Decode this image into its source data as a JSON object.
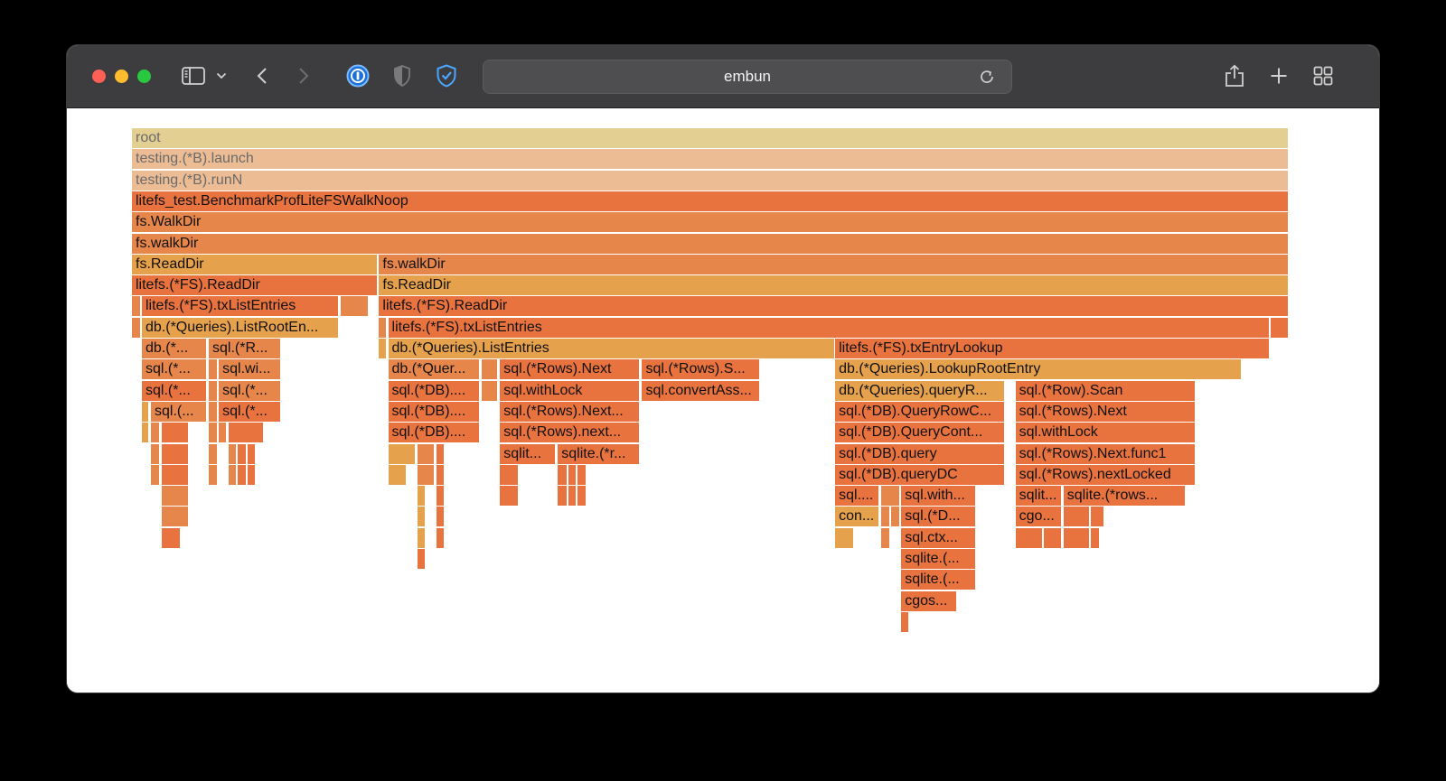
{
  "browser": {
    "url": "embun",
    "icons": {
      "sidebar": "sidebar-icon",
      "tab_menu": "chevron-down-icon",
      "back": "chevron-left-icon",
      "forward": "chevron-right-icon",
      "extension_1": "1password-icon",
      "extension_2": "shield-half-icon",
      "extension_3": "shield-check-icon",
      "reload": "reload-icon",
      "share": "share-icon",
      "new_tab": "plus-icon",
      "tab_overview": "grid-icon"
    }
  },
  "flamegraph": {
    "colors": {
      "root": "#e4cf93",
      "pale": "#ecbd95",
      "red": "#e9733f",
      "orange": "#e7864a",
      "amber": "#e6a14d"
    },
    "frames": [
      {
        "label": "root",
        "c": "root",
        "d": 0,
        "s": 0,
        "e": 1
      },
      {
        "label": "testing.(*B).launch",
        "c": "pale",
        "d": 1,
        "s": 0,
        "e": 1
      },
      {
        "label": "testing.(*B).runN",
        "c": "pale",
        "d": 2,
        "s": 0,
        "e": 1
      },
      {
        "label": "litefs_test.BenchmarkProfLiteFSWalkNoop",
        "c": "red",
        "d": 3,
        "s": 0,
        "e": 1
      },
      {
        "label": "fs.WalkDir",
        "c": "orange",
        "d": 4,
        "s": 0,
        "e": 1
      },
      {
        "label": "fs.walkDir",
        "c": "orange",
        "d": 5,
        "s": 0,
        "e": 1
      },
      {
        "label": "fs.ReadDir",
        "c": "amber",
        "d": 6,
        "s": 0,
        "e": 0.2128
      },
      {
        "label": "fs.walkDir",
        "c": "orange",
        "d": 6,
        "s": 0.2136,
        "e": 1
      },
      {
        "label": "litefs.(*FS).ReadDir",
        "c": "red",
        "d": 7,
        "s": 0,
        "e": 0.2128
      },
      {
        "label": "fs.ReadDir",
        "c": "amber",
        "d": 7,
        "s": 0.2136,
        "e": 1
      },
      {
        "label": "",
        "c": "orange",
        "d": 8,
        "s": 0,
        "e": 0.0078
      },
      {
        "label": "litefs.(*FS).txListEntries",
        "c": "red",
        "d": 8,
        "s": 0.0086,
        "e": 0.1791
      },
      {
        "label": "",
        "c": "orange",
        "d": 8,
        "s": 0.1806,
        "e": 0.2048
      },
      {
        "label": "litefs.(*FS).ReadDir",
        "c": "red",
        "d": 8,
        "s": 0.2136,
        "e": 1
      },
      {
        "label": "",
        "c": "orange",
        "d": 9,
        "s": 0,
        "e": 0.0078
      },
      {
        "label": "db.(*Queries).ListRootEn...",
        "c": "amber",
        "d": 9,
        "s": 0.0086,
        "e": 0.1791
      },
      {
        "label": "",
        "c": "orange",
        "d": 9,
        "s": 0.2136,
        "e": 0.2207
      },
      {
        "label": "litefs.(*FS).txListEntries",
        "c": "red",
        "d": 9,
        "s": 0.2215,
        "e": 0.9836
      },
      {
        "label": "",
        "c": "red",
        "d": 9,
        "s": 0.9844,
        "e": 1
      },
      {
        "label": "db.(*...",
        "c": "orange",
        "d": 10,
        "s": 0.0086,
        "e": 0.0649
      },
      {
        "label": "sql.(*R...",
        "c": "orange",
        "d": 10,
        "s": 0.0664,
        "e": 0.129
      },
      {
        "label": "",
        "c": "amber",
        "d": 10,
        "s": 0.2136,
        "e": 0.2207
      },
      {
        "label": "db.(*Queries).ListEntries",
        "c": "amber",
        "d": 10,
        "s": 0.2215,
        "e": 0.6079
      },
      {
        "label": "litefs.(*FS).txEntryLookup",
        "c": "red",
        "d": 10,
        "s": 0.6079,
        "e": 0.9836
      },
      {
        "label": "sql.(*...",
        "c": "orange",
        "d": 11,
        "s": 0.0086,
        "e": 0.0649
      },
      {
        "label": "",
        "c": "orange",
        "d": 11,
        "s": 0.0664,
        "e": 0.0743
      },
      {
        "label": "sql.wi...",
        "c": "orange",
        "d": 11,
        "s": 0.0751,
        "e": 0.129
      },
      {
        "label": "db.(*Quer...",
        "c": "orange",
        "d": 11,
        "s": 0.2215,
        "e": 0.3009
      },
      {
        "label": "",
        "c": "orange",
        "d": 11,
        "s": 0.3025,
        "e": 0.3166
      },
      {
        "label": "sql.(*Rows).Next",
        "c": "red",
        "d": 11,
        "s": 0.3182,
        "e": 0.4394
      },
      {
        "label": "sql.(*Rows).S...",
        "c": "red",
        "d": 11,
        "s": 0.441,
        "e": 0.543
      },
      {
        "label": "db.(*Queries).LookupRootEntry",
        "c": "amber",
        "d": 11,
        "s": 0.6079,
        "e": 0.9593
      },
      {
        "label": "sql.(*...",
        "c": "red",
        "d": 12,
        "s": 0.0086,
        "e": 0.0649
      },
      {
        "label": "",
        "c": "orange",
        "d": 12,
        "s": 0.0664,
        "e": 0.0743
      },
      {
        "label": "sql.(*...",
        "c": "orange",
        "d": 12,
        "s": 0.0751,
        "e": 0.129
      },
      {
        "label": "sql.(*DB)....",
        "c": "red",
        "d": 12,
        "s": 0.2215,
        "e": 0.3009
      },
      {
        "label": "",
        "c": "orange",
        "d": 12,
        "s": 0.3025,
        "e": 0.3166
      },
      {
        "label": "sql.withLock",
        "c": "red",
        "d": 12,
        "s": 0.3182,
        "e": 0.4394
      },
      {
        "label": "sql.convertAss...",
        "c": "red",
        "d": 12,
        "s": 0.441,
        "e": 0.543
      },
      {
        "label": "db.(*Queries).queryR...",
        "c": "amber",
        "d": 12,
        "s": 0.6079,
        "e": 0.7544
      },
      {
        "label": "sql.(*Row).Scan",
        "c": "red",
        "d": 12,
        "s": 0.7638,
        "e": 0.9194
      },
      {
        "label": "",
        "c": "amber",
        "d": 13,
        "s": 0.0086,
        "e": 0.0149
      },
      {
        "label": "sql.(...",
        "c": "orange",
        "d": 13,
        "s": 0.0164,
        "e": 0.0649
      },
      {
        "label": "",
        "c": "orange",
        "d": 13,
        "s": 0.0664,
        "e": 0.0743
      },
      {
        "label": "sql.(*...",
        "c": "red",
        "d": 13,
        "s": 0.0751,
        "e": 0.129
      },
      {
        "label": "sql.(*DB)....",
        "c": "red",
        "d": 13,
        "s": 0.2215,
        "e": 0.3009
      },
      {
        "label": "sql.(*Rows).Next...",
        "c": "red",
        "d": 13,
        "s": 0.3182,
        "e": 0.4394
      },
      {
        "label": "sql.(*DB).QueryRowC...",
        "c": "red",
        "d": 13,
        "s": 0.6079,
        "e": 0.7544
      },
      {
        "label": "sql.(*Rows).Next",
        "c": "red",
        "d": 13,
        "s": 0.7638,
        "e": 0.9194
      },
      {
        "label": "",
        "c": "amber",
        "d": 14,
        "s": 0.0086,
        "e": 0.0149
      },
      {
        "label": "",
        "c": "orange",
        "d": 14,
        "s": 0.0164,
        "e": 0.0243
      },
      {
        "label": "",
        "c": "red",
        "d": 14,
        "s": 0.0258,
        "e": 0.0493
      },
      {
        "label": "",
        "c": "orange",
        "d": 14,
        "s": 0.0664,
        "e": 0.0743
      },
      {
        "label": "",
        "c": "orange",
        "d": 14,
        "s": 0.0751,
        "e": 0.0821
      },
      {
        "label": "",
        "c": "red",
        "d": 14,
        "s": 0.0837,
        "e": 0.1142
      },
      {
        "label": "sql.(*DB)....",
        "c": "red",
        "d": 14,
        "s": 0.2215,
        "e": 0.3009
      },
      {
        "label": "sql.(*Rows).next...",
        "c": "red",
        "d": 14,
        "s": 0.3182,
        "e": 0.4394
      },
      {
        "label": "sql.(*DB).QueryCont...",
        "c": "red",
        "d": 14,
        "s": 0.6079,
        "e": 0.7544
      },
      {
        "label": "sql.withLock",
        "c": "red",
        "d": 14,
        "s": 0.7638,
        "e": 0.9194
      },
      {
        "label": "",
        "c": "orange",
        "d": 15,
        "s": 0.0164,
        "e": 0.0243
      },
      {
        "label": "",
        "c": "red",
        "d": 15,
        "s": 0.0258,
        "e": 0.0493
      },
      {
        "label": "",
        "c": "orange",
        "d": 15,
        "s": 0.0664,
        "e": 0.0743
      },
      {
        "label": "",
        "c": "orange",
        "d": 15,
        "s": 0.0837,
        "e": 0.0907
      },
      {
        "label": "",
        "c": "red",
        "d": 15,
        "s": 0.0915,
        "e": 0.0993
      },
      {
        "label": "",
        "c": "red",
        "d": 15,
        "s": 0.1001,
        "e": 0.1072
      },
      {
        "label": "",
        "c": "amber",
        "d": 15,
        "s": 0.2215,
        "e": 0.245
      },
      {
        "label": "",
        "c": "orange",
        "d": 15,
        "s": 0.2466,
        "e": 0.2614
      },
      {
        "label": "",
        "c": "red",
        "d": 15,
        "s": 0.263,
        "e": 0.2701
      },
      {
        "label": "sqlit...",
        "c": "red",
        "d": 15,
        "s": 0.3182,
        "e": 0.3667
      },
      {
        "label": "sqlite.(*r...",
        "c": "red",
        "d": 15,
        "s": 0.3682,
        "e": 0.4394
      },
      {
        "label": "sql.(*DB).query",
        "c": "red",
        "d": 15,
        "s": 0.6079,
        "e": 0.7544
      },
      {
        "label": "sql.(*Rows).Next.func1",
        "c": "red",
        "d": 15,
        "s": 0.7638,
        "e": 0.9194
      },
      {
        "label": "",
        "c": "orange",
        "d": 16,
        "s": 0.0164,
        "e": 0.0243
      },
      {
        "label": "",
        "c": "red",
        "d": 16,
        "s": 0.0258,
        "e": 0.0493
      },
      {
        "label": "",
        "c": "orange",
        "d": 16,
        "s": 0.0664,
        "e": 0.0743
      },
      {
        "label": "",
        "c": "orange",
        "d": 16,
        "s": 0.0837,
        "e": 0.0907
      },
      {
        "label": "",
        "c": "red",
        "d": 16,
        "s": 0.0915,
        "e": 0.0993
      },
      {
        "label": "",
        "c": "red",
        "d": 16,
        "s": 0.1001,
        "e": 0.1072
      },
      {
        "label": "",
        "c": "amber",
        "d": 16,
        "s": 0.2215,
        "e": 0.2372
      },
      {
        "label": "",
        "c": "orange",
        "d": 16,
        "s": 0.2466,
        "e": 0.2614
      },
      {
        "label": "",
        "c": "red",
        "d": 16,
        "s": 0.263,
        "e": 0.2701
      },
      {
        "label": "",
        "c": "red",
        "d": 16,
        "s": 0.3182,
        "e": 0.3346
      },
      {
        "label": "",
        "c": "red",
        "d": 16,
        "s": 0.3682,
        "e": 0.3768
      },
      {
        "label": "",
        "c": "red",
        "d": 16,
        "s": 0.3776,
        "e": 0.3846
      },
      {
        "label": "",
        "c": "red",
        "d": 16,
        "s": 0.3854,
        "e": 0.3932
      },
      {
        "label": "sql.(*DB).queryDC",
        "c": "red",
        "d": 16,
        "s": 0.6079,
        "e": 0.7544
      },
      {
        "label": "sql.(*Rows).nextLocked",
        "c": "red",
        "d": 16,
        "s": 0.7638,
        "e": 0.9194
      },
      {
        "label": "",
        "c": "orange",
        "d": 17,
        "s": 0.0258,
        "e": 0.0493
      },
      {
        "label": "",
        "c": "amber",
        "d": 17,
        "s": 0.2466,
        "e": 0.2536
      },
      {
        "label": "",
        "c": "red",
        "d": 17,
        "s": 0.263,
        "e": 0.2701
      },
      {
        "label": "",
        "c": "red",
        "d": 17,
        "s": 0.3182,
        "e": 0.3346
      },
      {
        "label": "",
        "c": "red",
        "d": 17,
        "s": 0.3682,
        "e": 0.3768
      },
      {
        "label": "",
        "c": "red",
        "d": 17,
        "s": 0.3776,
        "e": 0.3846
      },
      {
        "label": "",
        "c": "red",
        "d": 17,
        "s": 0.3854,
        "e": 0.3932
      },
      {
        "label": "sql....",
        "c": "red",
        "d": 17,
        "s": 0.6079,
        "e": 0.6462
      },
      {
        "label": "",
        "c": "orange",
        "d": 17,
        "s": 0.6478,
        "e": 0.6642
      },
      {
        "label": "sql.with...",
        "c": "red",
        "d": 17,
        "s": 0.665,
        "e": 0.7294
      },
      {
        "label": "sqlit...",
        "c": "red",
        "d": 17,
        "s": 0.7638,
        "e": 0.8037
      },
      {
        "label": "sqlite.(*rows...",
        "c": "red",
        "d": 17,
        "s": 0.8053,
        "e": 0.9108
      },
      {
        "label": "",
        "c": "orange",
        "d": 18,
        "s": 0.0258,
        "e": 0.0493
      },
      {
        "label": "",
        "c": "amber",
        "d": 18,
        "s": 0.2466,
        "e": 0.2536
      },
      {
        "label": "",
        "c": "red",
        "d": 18,
        "s": 0.263,
        "e": 0.2701
      },
      {
        "label": "con...",
        "c": "amber",
        "d": 18,
        "s": 0.6079,
        "e": 0.6462
      },
      {
        "label": "",
        "c": "orange",
        "d": 18,
        "s": 0.6478,
        "e": 0.6556
      },
      {
        "label": "",
        "c": "orange",
        "d": 18,
        "s": 0.6564,
        "e": 0.6642
      },
      {
        "label": "sql.(*D...",
        "c": "red",
        "d": 18,
        "s": 0.665,
        "e": 0.7294
      },
      {
        "label": "cgo...",
        "c": "red",
        "d": 18,
        "s": 0.7638,
        "e": 0.8037
      },
      {
        "label": "",
        "c": "red",
        "d": 18,
        "s": 0.8053,
        "e": 0.828
      },
      {
        "label": "",
        "c": "red",
        "d": 18,
        "s": 0.8288,
        "e": 0.8405
      },
      {
        "label": "",
        "c": "red",
        "d": 19,
        "s": 0.0258,
        "e": 0.0422
      },
      {
        "label": "",
        "c": "amber",
        "d": 19,
        "s": 0.2466,
        "e": 0.2536
      },
      {
        "label": "",
        "c": "red",
        "d": 19,
        "s": 0.263,
        "e": 0.2701
      },
      {
        "label": "",
        "c": "amber",
        "d": 19,
        "s": 0.6079,
        "e": 0.6243
      },
      {
        "label": "",
        "c": "orange",
        "d": 19,
        "s": 0.6478,
        "e": 0.6556
      },
      {
        "label": "sql.ctx...",
        "c": "red",
        "d": 19,
        "s": 0.665,
        "e": 0.7294
      },
      {
        "label": "",
        "c": "red",
        "d": 19,
        "s": 0.7638,
        "e": 0.7872
      },
      {
        "label": "",
        "c": "red",
        "d": 19,
        "s": 0.788,
        "e": 0.8037
      },
      {
        "label": "",
        "c": "red",
        "d": 19,
        "s": 0.8053,
        "e": 0.828
      },
      {
        "label": "",
        "c": "red",
        "d": 19,
        "s": 0.8288,
        "e": 0.8366
      },
      {
        "label": "",
        "c": "red",
        "d": 20,
        "s": 0.2466,
        "e": 0.2536
      },
      {
        "label": "sqlite.(...",
        "c": "red",
        "d": 20,
        "s": 0.665,
        "e": 0.7294
      },
      {
        "label": "sqlite.(...",
        "c": "red",
        "d": 21,
        "s": 0.665,
        "e": 0.7294
      },
      {
        "label": "cgos...",
        "c": "red",
        "d": 22,
        "s": 0.665,
        "e": 0.713
      },
      {
        "label": "",
        "c": "red",
        "d": 23,
        "s": 0.665,
        "e": 0.672
      }
    ]
  }
}
